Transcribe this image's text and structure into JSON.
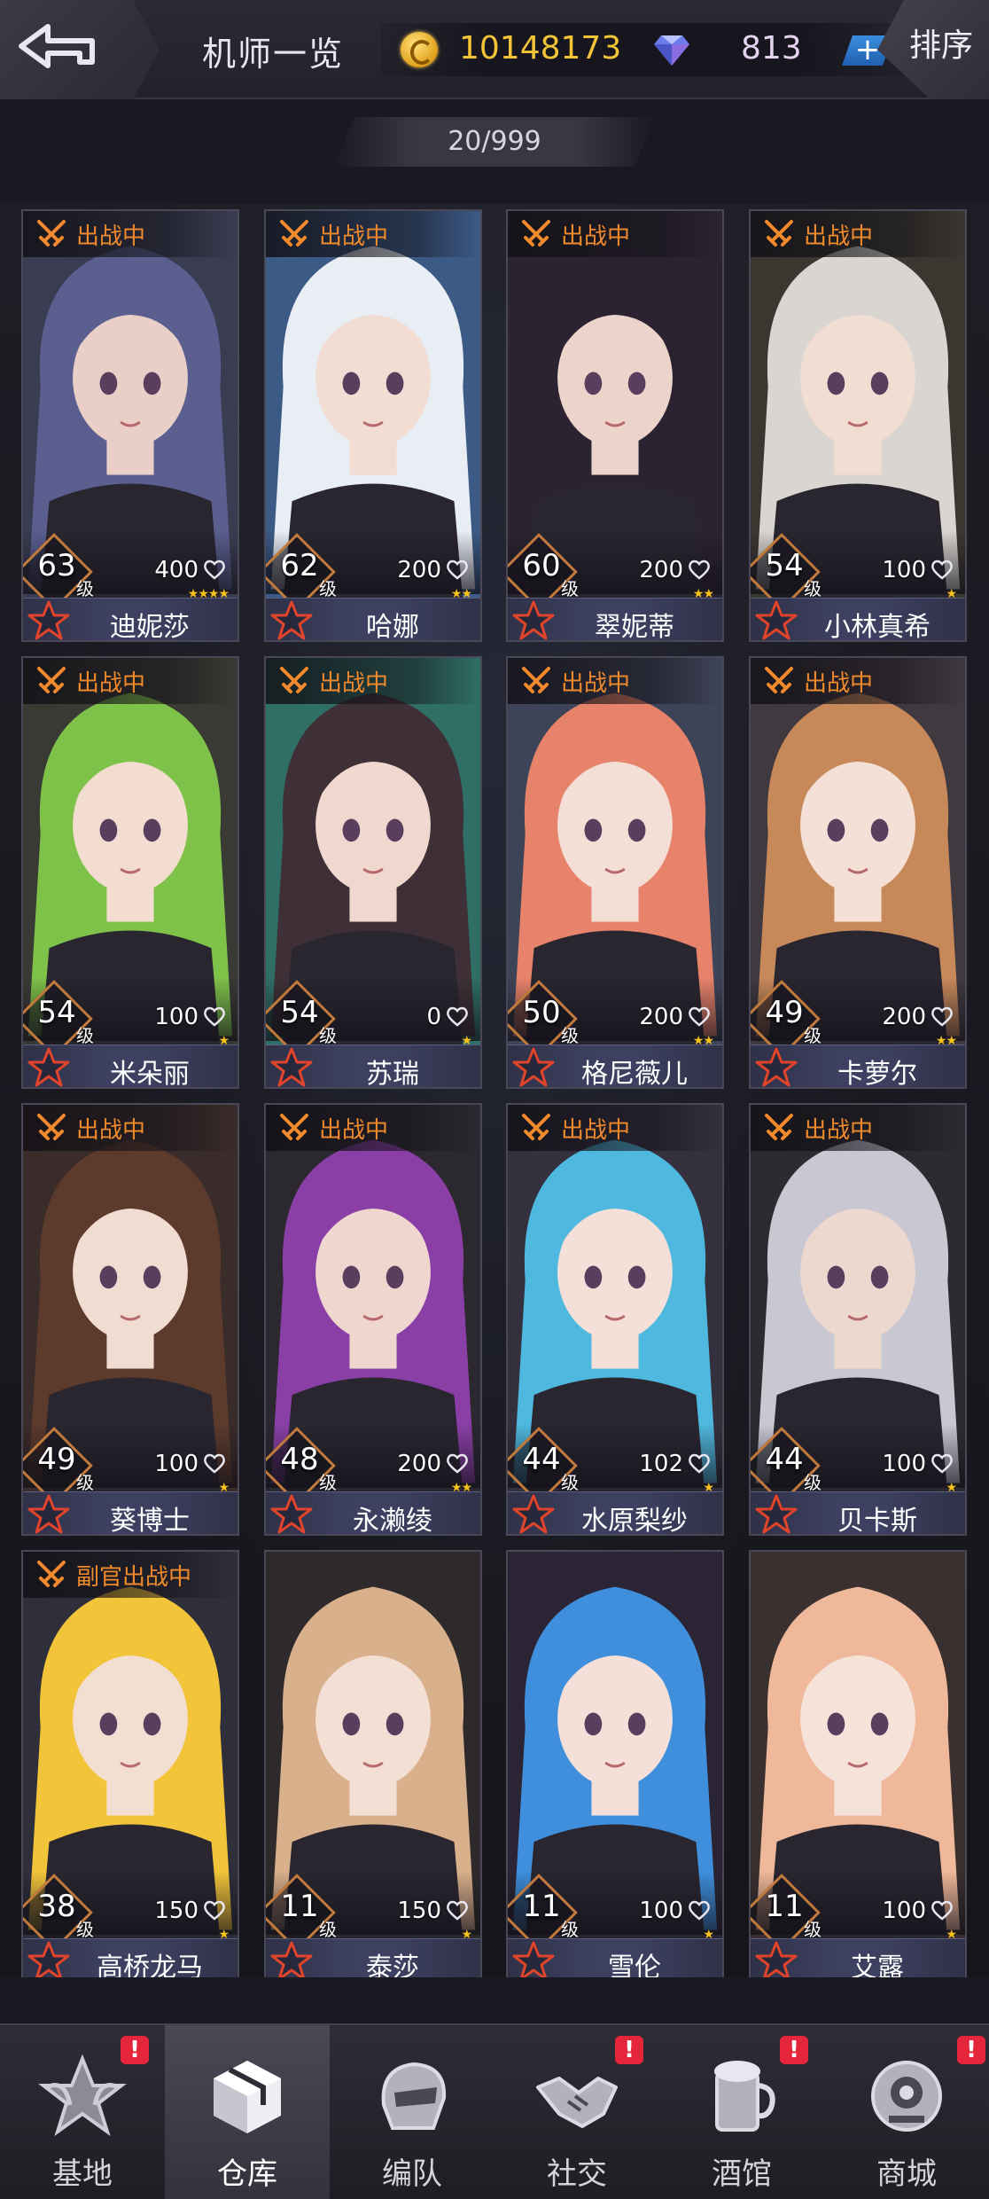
{
  "header": {
    "title": "机师一览",
    "gold": "10148173",
    "gems": "813",
    "plus_label": "+",
    "sort_label": "排序"
  },
  "roster_count": "20/999",
  "pilots": [
    {
      "name": "迪妮莎",
      "level": "63",
      "level_unit": "级",
      "power": "400",
      "stars": "★★★★",
      "status": "出战中",
      "hair": "#5b5f8f",
      "skin": "#e9cfc8",
      "bg": "#3a3d52"
    },
    {
      "name": "哈娜",
      "level": "62",
      "level_unit": "级",
      "power": "200",
      "stars": "★★",
      "status": "出战中",
      "hair": "#e9eef5",
      "skin": "#f2ddd4",
      "bg": "#3b5a86"
    },
    {
      "name": "翠妮蒂",
      "level": "60",
      "level_unit": "级",
      "power": "200",
      "stars": "★★",
      "status": "出战中",
      "hair": "#2b2232",
      "skin": "#ecd4cb",
      "bg": "#2a2430"
    },
    {
      "name": "小林真希",
      "level": "54",
      "level_unit": "级",
      "power": "100",
      "stars": "★",
      "status": "出战中",
      "hair": "#d9d5d0",
      "skin": "#f1ddd2",
      "bg": "#3a3630"
    },
    {
      "name": "米朵丽",
      "level": "54",
      "level_unit": "级",
      "power": "100",
      "stars": "★",
      "status": "出战中",
      "hair": "#7fc24a",
      "skin": "#f3dcd0",
      "bg": "#3a3a34"
    },
    {
      "name": "苏瑞",
      "level": "54",
      "level_unit": "级",
      "power": "0",
      "stars": "★",
      "status": "出战中",
      "hair": "#3e3036",
      "skin": "#f0d8cf",
      "bg": "#2f6f66"
    },
    {
      "name": "格尼薇儿",
      "level": "50",
      "level_unit": "级",
      "power": "200",
      "stars": "★★",
      "status": "出战中",
      "hair": "#e7836a",
      "skin": "#f4dfd6",
      "bg": "#3e4458"
    },
    {
      "name": "卡萝尔",
      "level": "49",
      "level_unit": "级",
      "power": "200",
      "stars": "★★",
      "status": "出战中",
      "hair": "#c8895a",
      "skin": "#f4e0d6",
      "bg": "#403a40"
    },
    {
      "name": "葵博士",
      "level": "49",
      "level_unit": "级",
      "power": "100",
      "stars": "★",
      "status": "出战中",
      "hair": "#5c3a2c",
      "skin": "#f1dcd2",
      "bg": "#3a2c2a"
    },
    {
      "name": "永濑绫",
      "level": "48",
      "level_unit": "级",
      "power": "200",
      "stars": "★★",
      "status": "出战中",
      "hair": "#8a3fa6",
      "skin": "#efd7cf",
      "bg": "#2c2830"
    },
    {
      "name": "水原梨纱",
      "level": "44",
      "level_unit": "级",
      "power": "102",
      "stars": "★",
      "status": "出战中",
      "hair": "#4fb8de",
      "skin": "#f4e0d8",
      "bg": "#34303e"
    },
    {
      "name": "贝卡斯",
      "level": "44",
      "level_unit": "级",
      "power": "100",
      "stars": "★",
      "status": "出战中",
      "hair": "#c9c7d2",
      "skin": "#ecd8ce",
      "bg": "#2c2c30"
    },
    {
      "name": "高桥龙马",
      "level": "38",
      "level_unit": "级",
      "power": "150",
      "stars": "★",
      "status": "副官出战中",
      "hair": "#f2c43a",
      "skin": "#f3dfd2",
      "bg": "#2e2f3a"
    },
    {
      "name": "泰莎",
      "level": "11",
      "level_unit": "级",
      "power": "150",
      "stars": "★",
      "status": "",
      "hair": "#d9b08c",
      "skin": "#f4dfd4",
      "bg": "#2e2a2c"
    },
    {
      "name": "雪伦",
      "level": "11",
      "level_unit": "级",
      "power": "100",
      "stars": "★",
      "status": "",
      "hair": "#3f8fdc",
      "skin": "#f4e0d8",
      "bg": "#2a2434"
    },
    {
      "name": "艾露",
      "level": "11",
      "level_unit": "级",
      "power": "100",
      "stars": "★",
      "status": "",
      "hair": "#f0b89a",
      "skin": "#f5e2d8",
      "bg": "#3a3030"
    }
  ],
  "nav": [
    {
      "label": "基地",
      "icon": "base-star-icon",
      "alert": "!"
    },
    {
      "label": "仓库",
      "icon": "warehouse-cube-icon",
      "alert": ""
    },
    {
      "label": "编队",
      "icon": "formation-helmet-icon",
      "alert": ""
    },
    {
      "label": "社交",
      "icon": "handshake-icon",
      "alert": "!"
    },
    {
      "label": "酒馆",
      "icon": "tavern-mug-icon",
      "alert": "!"
    },
    {
      "label": "商城",
      "icon": "shop-robot-icon",
      "alert": "!"
    }
  ],
  "colors": {
    "status_orange": "#f08a2c",
    "gold_text": "#f3c436",
    "alert_red": "#e5263a",
    "name_bar": "#3d4060",
    "rarity_star": "#f7c21b"
  }
}
